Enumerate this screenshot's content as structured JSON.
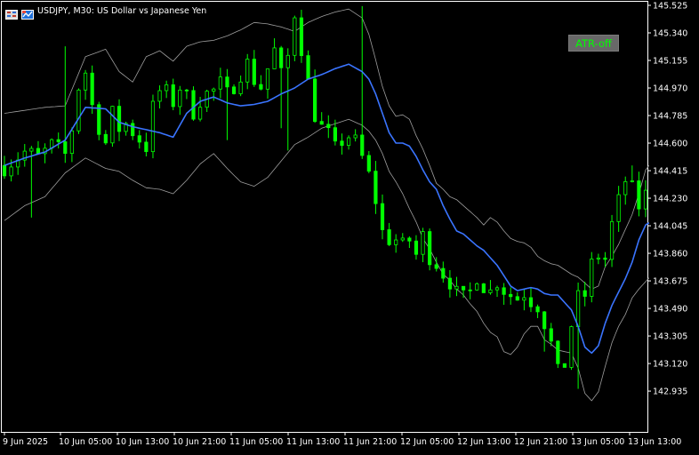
{
  "chart_header": {
    "symbol_title": "USDJPY, M30:  US Dollar vs Japanese Yen"
  },
  "atr_button": {
    "label": "ATR-off"
  },
  "colors": {
    "background": "#000000",
    "frame": "#ffffff",
    "candle": "#00ff00",
    "moving_average": "#3a74ff",
    "band": "#9e9e9e",
    "axis_text": "#ffffff",
    "button_background": "#686868",
    "button_text": "#00ff00"
  },
  "icons": {
    "chart_window_icon": "window-grid-icon",
    "expert_icon": "expert-advisor-icon"
  },
  "chart_data": {
    "type": "candlestick",
    "symbol": "USDJPY",
    "timeframe": "M30",
    "title": "USDJPY, M30:  US Dollar vs Japanese Yen",
    "y_ticks": [
      "145.525",
      "145.340",
      "145.155",
      "144.970",
      "144.785",
      "144.600",
      "144.415",
      "144.230",
      "144.045",
      "143.860",
      "143.675",
      "143.490",
      "143.305",
      "143.120",
      "142.935"
    ],
    "x_ticks": [
      "9 Jun 2025",
      "10 Jun 05:00",
      "10 Jun 13:00",
      "10 Jun 21:00",
      "11 Jun 05:00",
      "11 Jun 13:00",
      "11 Jun 21:00",
      "12 Jun 05:00",
      "12 Jun 13:00",
      "12 Jun 21:00",
      "13 Jun 05:00",
      "13 Jun 13:00"
    ],
    "ylim": [
      142.86,
      145.54
    ],
    "grid": false,
    "moving_average": [
      [
        0,
        144.45
      ],
      [
        3,
        144.5
      ],
      [
        6,
        144.54
      ],
      [
        9,
        144.62
      ],
      [
        12,
        144.84
      ],
      [
        15,
        144.83
      ],
      [
        17,
        144.74
      ],
      [
        19,
        144.71
      ],
      [
        21,
        144.69
      ],
      [
        23,
        144.67
      ],
      [
        25,
        144.64
      ],
      [
        27,
        144.8
      ],
      [
        29,
        144.88
      ],
      [
        31,
        144.91
      ],
      [
        33,
        144.87
      ],
      [
        35,
        144.85
      ],
      [
        37,
        144.86
      ],
      [
        39,
        144.88
      ],
      [
        41,
        144.93
      ],
      [
        43,
        144.97
      ],
      [
        45,
        145.03
      ],
      [
        47,
        145.06
      ],
      [
        49,
        145.1
      ],
      [
        51,
        145.13
      ],
      [
        53,
        145.08
      ],
      [
        54,
        145.03
      ],
      [
        55,
        144.93
      ],
      [
        56,
        144.8
      ],
      [
        57,
        144.67
      ],
      [
        58,
        144.6
      ],
      [
        59,
        144.6
      ],
      [
        60,
        144.58
      ],
      [
        61,
        144.51
      ],
      [
        62,
        144.42
      ],
      [
        63,
        144.34
      ],
      [
        64,
        144.29
      ],
      [
        65,
        144.18
      ],
      [
        66,
        144.09
      ],
      [
        67,
        144.01
      ],
      [
        68,
        143.99
      ],
      [
        69,
        143.95
      ],
      [
        70,
        143.91
      ],
      [
        71,
        143.88
      ],
      [
        72,
        143.83
      ],
      [
        73,
        143.78
      ],
      [
        74,
        143.71
      ],
      [
        75,
        143.64
      ],
      [
        76,
        143.61
      ],
      [
        77,
        143.62
      ],
      [
        78,
        143.63
      ],
      [
        79,
        143.62
      ],
      [
        80,
        143.59
      ],
      [
        81,
        143.58
      ],
      [
        82,
        143.58
      ],
      [
        83,
        143.53
      ],
      [
        84,
        143.48
      ],
      [
        85,
        143.37
      ],
      [
        86,
        143.23
      ],
      [
        87,
        143.19
      ],
      [
        88,
        143.24
      ],
      [
        89,
        143.39
      ],
      [
        90,
        143.51
      ],
      [
        91,
        143.6
      ],
      [
        92,
        143.69
      ],
      [
        93,
        143.8
      ],
      [
        94,
        143.95
      ],
      [
        95,
        144.05
      ],
      [
        96,
        144.08
      ]
    ],
    "upper_band": [
      [
        0,
        144.8
      ],
      [
        3,
        144.82
      ],
      [
        6,
        144.84
      ],
      [
        9,
        144.85
      ],
      [
        12,
        145.18
      ],
      [
        15,
        145.23
      ],
      [
        17,
        145.08
      ],
      [
        19,
        145.01
      ],
      [
        21,
        145.18
      ],
      [
        23,
        145.22
      ],
      [
        25,
        145.15
      ],
      [
        27,
        145.25
      ],
      [
        29,
        145.28
      ],
      [
        31,
        145.29
      ],
      [
        33,
        145.32
      ],
      [
        35,
        145.36
      ],
      [
        37,
        145.41
      ],
      [
        39,
        145.4
      ],
      [
        41,
        145.38
      ],
      [
        43,
        145.35
      ],
      [
        45,
        145.41
      ],
      [
        47,
        145.45
      ],
      [
        49,
        145.48
      ],
      [
        51,
        145.5
      ],
      [
        53,
        145.44
      ],
      [
        54,
        145.33
      ],
      [
        55,
        145.16
      ],
      [
        56,
        144.98
      ],
      [
        57,
        144.85
      ],
      [
        58,
        144.78
      ],
      [
        59,
        144.79
      ],
      [
        60,
        144.76
      ],
      [
        61,
        144.65
      ],
      [
        62,
        144.56
      ],
      [
        63,
        144.45
      ],
      [
        64,
        144.33
      ],
      [
        65,
        144.29
      ],
      [
        66,
        144.24
      ],
      [
        67,
        144.22
      ],
      [
        68,
        144.18
      ],
      [
        69,
        144.14
      ],
      [
        70,
        144.1
      ],
      [
        71,
        144.05
      ],
      [
        72,
        144.1
      ],
      [
        73,
        144.07
      ],
      [
        74,
        144.01
      ],
      [
        75,
        143.96
      ],
      [
        76,
        143.94
      ],
      [
        77,
        143.93
      ],
      [
        78,
        143.9
      ],
      [
        79,
        143.84
      ],
      [
        80,
        143.81
      ],
      [
        81,
        143.79
      ],
      [
        82,
        143.78
      ],
      [
        83,
        143.75
      ],
      [
        84,
        143.72
      ],
      [
        85,
        143.7
      ],
      [
        86,
        143.66
      ],
      [
        87,
        143.62
      ],
      [
        88,
        143.64
      ],
      [
        89,
        143.77
      ],
      [
        90,
        143.84
      ],
      [
        91,
        143.92
      ],
      [
        92,
        144.02
      ],
      [
        93,
        144.12
      ],
      [
        94,
        144.26
      ],
      [
        95,
        144.42
      ],
      [
        96,
        144.48
      ]
    ],
    "lower_band": [
      [
        0,
        144.08
      ],
      [
        3,
        144.18
      ],
      [
        6,
        144.24
      ],
      [
        9,
        144.4
      ],
      [
        12,
        144.5
      ],
      [
        15,
        144.43
      ],
      [
        17,
        144.41
      ],
      [
        19,
        144.35
      ],
      [
        21,
        144.3
      ],
      [
        23,
        144.29
      ],
      [
        25,
        144.26
      ],
      [
        27,
        144.35
      ],
      [
        29,
        144.46
      ],
      [
        31,
        144.53
      ],
      [
        33,
        144.43
      ],
      [
        35,
        144.34
      ],
      [
        37,
        144.31
      ],
      [
        39,
        144.37
      ],
      [
        41,
        144.48
      ],
      [
        43,
        144.59
      ],
      [
        45,
        144.64
      ],
      [
        47,
        144.7
      ],
      [
        49,
        144.73
      ],
      [
        51,
        144.76
      ],
      [
        53,
        144.72
      ],
      [
        54,
        144.68
      ],
      [
        55,
        144.62
      ],
      [
        56,
        144.53
      ],
      [
        57,
        144.41
      ],
      [
        58,
        144.34
      ],
      [
        59,
        144.26
      ],
      [
        60,
        144.16
      ],
      [
        61,
        144.07
      ],
      [
        62,
        143.96
      ],
      [
        63,
        143.89
      ],
      [
        64,
        143.8
      ],
      [
        65,
        143.72
      ],
      [
        66,
        143.68
      ],
      [
        67,
        143.62
      ],
      [
        68,
        143.58
      ],
      [
        69,
        143.52
      ],
      [
        70,
        143.47
      ],
      [
        71,
        143.39
      ],
      [
        72,
        143.33
      ],
      [
        73,
        143.3
      ],
      [
        74,
        143.2
      ],
      [
        75,
        143.18
      ],
      [
        76,
        143.23
      ],
      [
        77,
        143.32
      ],
      [
        78,
        143.37
      ],
      [
        79,
        143.37
      ],
      [
        80,
        143.28
      ],
      [
        81,
        143.25
      ],
      [
        82,
        143.21
      ],
      [
        83,
        143.2
      ],
      [
        84,
        143.19
      ],
      [
        85,
        143.09
      ],
      [
        86,
        142.92
      ],
      [
        87,
        142.87
      ],
      [
        88,
        142.93
      ],
      [
        89,
        143.1
      ],
      [
        90,
        143.26
      ],
      [
        91,
        143.37
      ],
      [
        92,
        143.45
      ],
      [
        93,
        143.56
      ],
      [
        94,
        143.62
      ],
      [
        95,
        143.67
      ],
      [
        96,
        143.72
      ]
    ],
    "candle_anchors": [
      [
        0,
        144.45
      ],
      [
        3,
        144.54
      ],
      [
        5,
        144.5
      ],
      [
        7,
        144.58
      ],
      [
        9,
        144.52
      ],
      [
        10,
        144.7
      ],
      [
        11,
        144.98
      ],
      [
        12,
        145.08
      ],
      [
        13,
        144.85
      ],
      [
        14,
        144.72
      ],
      [
        15,
        144.6
      ],
      [
        16,
        144.79
      ],
      [
        17,
        144.7
      ],
      [
        18,
        144.73
      ],
      [
        19,
        144.68
      ],
      [
        20,
        144.63
      ],
      [
        21,
        144.58
      ],
      [
        22,
        144.83
      ],
      [
        23,
        144.95
      ],
      [
        24,
        144.93
      ],
      [
        25,
        144.88
      ],
      [
        26,
        144.98
      ],
      [
        27,
        144.9
      ],
      [
        28,
        144.82
      ],
      [
        29,
        144.9
      ],
      [
        30,
        144.93
      ],
      [
        31,
        144.95
      ],
      [
        32,
        144.99
      ],
      [
        33,
        144.92
      ],
      [
        34,
        145.0
      ],
      [
        35,
        145.08
      ],
      [
        36,
        145.13
      ],
      [
        37,
        145.03
      ],
      [
        38,
        144.98
      ],
      [
        39,
        145.1
      ],
      [
        40,
        145.22
      ],
      [
        41,
        145.05
      ],
      [
        42,
        145.18
      ],
      [
        43,
        145.48
      ],
      [
        44,
        145.25
      ],
      [
        45,
        145.0
      ],
      [
        46,
        144.8
      ],
      [
        47,
        144.7
      ],
      [
        48,
        144.65
      ],
      [
        49,
        144.55
      ],
      [
        50,
        144.62
      ],
      [
        51,
        144.65
      ],
      [
        52,
        144.6
      ],
      [
        53,
        144.5
      ],
      [
        54,
        144.38
      ],
      [
        55,
        144.22
      ],
      [
        56,
        144.0
      ],
      [
        57,
        143.96
      ],
      [
        58,
        143.95
      ],
      [
        59,
        143.9
      ],
      [
        60,
        143.95
      ],
      [
        61,
        143.85
      ],
      [
        62,
        143.97
      ],
      [
        63,
        143.85
      ],
      [
        64,
        143.8
      ],
      [
        65,
        143.73
      ],
      [
        66,
        143.68
      ],
      [
        67,
        143.58
      ],
      [
        68,
        143.55
      ],
      [
        69,
        143.6
      ],
      [
        70,
        143.72
      ],
      [
        71,
        143.65
      ],
      [
        72,
        143.6
      ],
      [
        73,
        143.68
      ],
      [
        74,
        143.62
      ],
      [
        75,
        143.58
      ],
      [
        76,
        143.56
      ],
      [
        77,
        143.6
      ],
      [
        78,
        143.55
      ],
      [
        79,
        143.52
      ],
      [
        80,
        143.4
      ],
      [
        81,
        143.25
      ],
      [
        82,
        143.05
      ],
      [
        83,
        143.12
      ],
      [
        84,
        143.38
      ],
      [
        85,
        143.55
      ],
      [
        86,
        143.58
      ],
      [
        87,
        143.78
      ],
      [
        88,
        143.85
      ],
      [
        89,
        143.82
      ],
      [
        90,
        144.05
      ],
      [
        91,
        144.2
      ],
      [
        92,
        144.35
      ],
      [
        93,
        144.28
      ],
      [
        94,
        144.18
      ],
      [
        95,
        144.25
      ]
    ],
    "candle_count": 96,
    "spike_marks": [
      [
        4,
        144.1
      ],
      [
        33,
        144.62
      ],
      [
        9,
        145.25
      ],
      [
        53,
        145.52
      ],
      [
        41,
        144.7
      ],
      [
        42,
        144.55
      ],
      [
        80,
        143.2
      ],
      [
        85,
        142.95
      ],
      [
        87,
        143.8
      ],
      [
        93,
        144.45
      ]
    ]
  }
}
